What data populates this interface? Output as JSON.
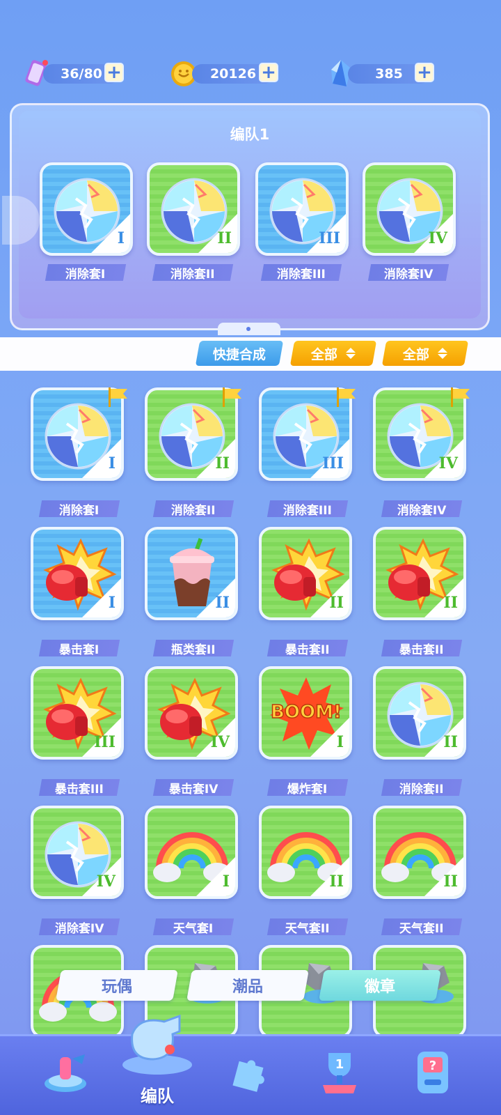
{
  "resources": {
    "stamina": {
      "value": "36/80",
      "icon": "stamina-card-icon"
    },
    "coins": {
      "value": "20126",
      "icon": "coin-icon"
    },
    "gems": {
      "value": "385",
      "icon": "crystal-icon"
    },
    "plus": "+"
  },
  "team_panel": {
    "title": "编队1",
    "slots": [
      {
        "label": "消除套I",
        "roman": "I",
        "bg": "blue",
        "art": "crystal-ball"
      },
      {
        "label": "消除套II",
        "roman": "II",
        "bg": "green",
        "art": "crystal-ball"
      },
      {
        "label": "消除套III",
        "roman": "III",
        "bg": "blue",
        "art": "crystal-ball"
      },
      {
        "label": "消除套IV",
        "roman": "IV",
        "bg": "green",
        "art": "crystal-ball"
      }
    ]
  },
  "toolbar": {
    "quick_merge": "快捷合成",
    "filter1": "全部",
    "filter2": "全部"
  },
  "badges": [
    {
      "label": "消除套I",
      "roman": "I",
      "bg": "blue",
      "art": "crystal-ball",
      "flag": true
    },
    {
      "label": "消除套II",
      "roman": "II",
      "bg": "green",
      "art": "crystal-ball",
      "flag": true
    },
    {
      "label": "消除套III",
      "roman": "III",
      "bg": "blue",
      "art": "crystal-ball",
      "flag": true
    },
    {
      "label": "消除套IV",
      "roman": "IV",
      "bg": "green",
      "art": "crystal-ball",
      "flag": true
    },
    {
      "label": "暴击套I",
      "roman": "I",
      "bg": "blue",
      "art": "boxing-glove"
    },
    {
      "label": "瓶类套II",
      "roman": "II",
      "bg": "blue",
      "art": "milk-tea"
    },
    {
      "label": "暴击套II",
      "roman": "II",
      "bg": "green",
      "art": "boxing-glove"
    },
    {
      "label": "暴击套II",
      "roman": "II",
      "bg": "green",
      "art": "boxing-glove"
    },
    {
      "label": "暴击套III",
      "roman": "III",
      "bg": "green",
      "art": "boxing-glove"
    },
    {
      "label": "暴击套IV",
      "roman": "IV",
      "bg": "green",
      "art": "boxing-glove"
    },
    {
      "label": "爆炸套I",
      "roman": "I",
      "bg": "green",
      "art": "boom"
    },
    {
      "label": "消除套II",
      "roman": "II",
      "bg": "green",
      "art": "crystal-ball"
    },
    {
      "label": "消除套IV",
      "roman": "IV",
      "bg": "green",
      "art": "crystal-ball"
    },
    {
      "label": "天气套I",
      "roman": "I",
      "bg": "green",
      "art": "rainbow"
    },
    {
      "label": "天气套II",
      "roman": "II",
      "bg": "green",
      "art": "rainbow"
    },
    {
      "label": "天气套II",
      "roman": "II",
      "bg": "green",
      "art": "rainbow"
    }
  ],
  "partial_row": [
    {
      "bg": "green",
      "art": "rainbow"
    },
    {
      "bg": "green",
      "art": "rock"
    },
    {
      "bg": "green",
      "art": "rock"
    },
    {
      "bg": "green",
      "art": "rock"
    }
  ],
  "bottom_tabs": [
    {
      "label": "玩偶",
      "active": false
    },
    {
      "label": "潮品",
      "active": false
    },
    {
      "label": "徽章",
      "active": true
    }
  ],
  "nav": {
    "center_label": "编队",
    "items": [
      "stage-icon",
      "whistle-icon",
      "puzzle-icon",
      "trophy-icon",
      "mystery-machine-icon"
    ]
  },
  "colors": {
    "accent_blue": "#5a85e6",
    "filter_yellow": "#f5a000",
    "active_tab": "#6fd8de"
  },
  "boom_text": "BOOM!"
}
